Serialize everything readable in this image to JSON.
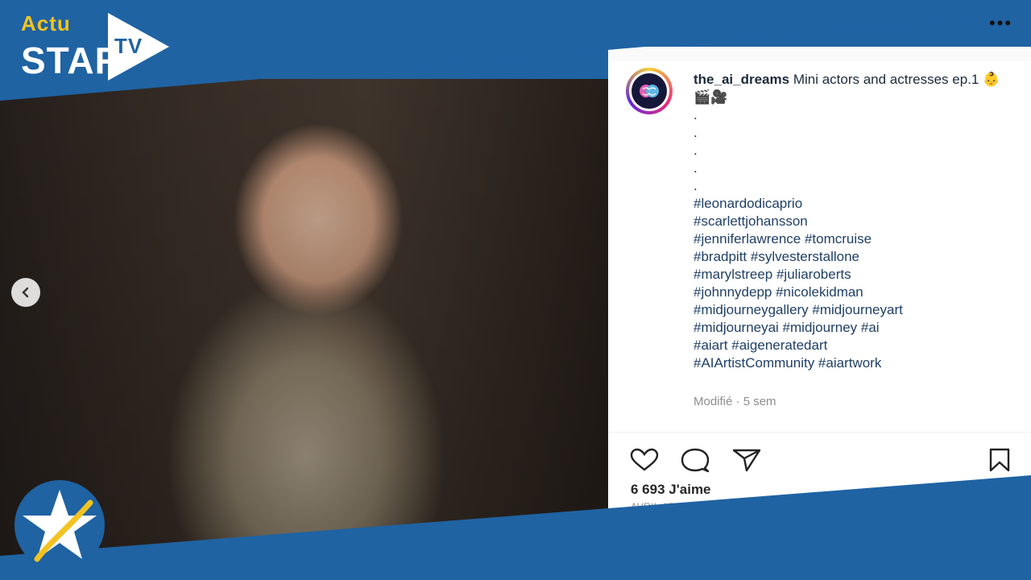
{
  "brand": {
    "actu": "Actu",
    "star": "STAR",
    "tv": "TV",
    "accent_blue": "#1f63a3",
    "accent_yellow": "#f2c320"
  },
  "post": {
    "username": "the_ai_dreams",
    "title": "Mini actors and actresses ep.1",
    "emojis": "👶🎬🎥",
    "dots": [
      ".",
      ".",
      ".",
      ".",
      "."
    ],
    "hashtag_lines": [
      "#leonardodicaprio",
      "#scarlettjohansson",
      "#jenniferlawrence #tomcruise",
      "#bradpitt #sylvesterstallone",
      "#marylstreep #juliaroberts",
      "#johnnydepp #nicolekidman",
      "#midjourneygallery #midjourneyart",
      "#midjourneyai #midjourney #ai",
      "#aiart #aigeneratedart",
      "#AIArtistCommunity #aiartwork"
    ],
    "edited": "Modifié",
    "separator": "·",
    "age": "5 sem",
    "likes": "6 693 J'aime",
    "date": "AVRIL 15"
  },
  "icons": {
    "menu": "more-icon",
    "like": "heart-icon",
    "comment": "comment-icon",
    "share": "send-icon",
    "save": "bookmark-icon",
    "prev": "chevron-left-icon"
  }
}
